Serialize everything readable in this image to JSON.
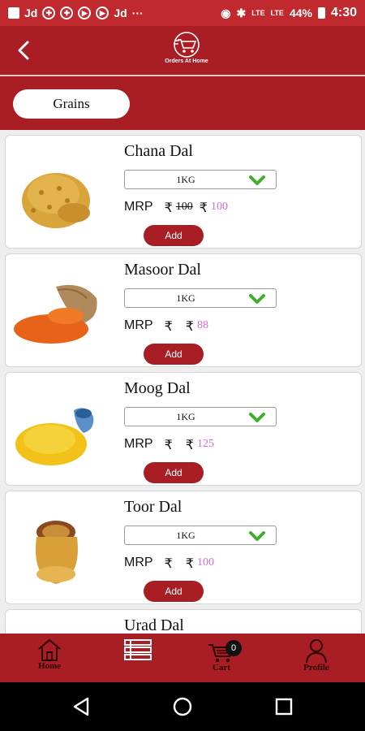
{
  "status_bar": {
    "left_items": [
      "Jd",
      "Jd",
      "···"
    ],
    "signal_labels": [
      "LTE",
      "LTE"
    ],
    "battery": "44%",
    "time": "4:30"
  },
  "header": {
    "logo_text": "Orders At Home",
    "back_icon": "chevron-left-icon",
    "logo_icon": "cart-icon"
  },
  "category": {
    "selected": "Grains"
  },
  "products": [
    {
      "name": "Chana Dal",
      "qty": "1KG",
      "mrp_label": "MRP",
      "currency": "₹",
      "old_price": "100",
      "new_price": "100",
      "add_label": "Add"
    },
    {
      "name": "Masoor Dal",
      "qty": "1KG",
      "mrp_label": "MRP",
      "currency": "₹",
      "old_price": "",
      "new_price": "88",
      "add_label": "Add"
    },
    {
      "name": "Moog Dal",
      "qty": "1KG",
      "mrp_label": "MRP",
      "currency": "₹",
      "old_price": "",
      "new_price": "125",
      "add_label": "Add"
    },
    {
      "name": "Toor Dal",
      "qty": "1KG",
      "mrp_label": "MRP",
      "currency": "₹",
      "old_price": "",
      "new_price": "100",
      "add_label": "Add"
    },
    {
      "name": "Urad Dal"
    }
  ],
  "bottom_nav": {
    "home": "Home",
    "menu_icon": "list-icon",
    "cart": "Cart",
    "cart_count": "0",
    "profile": "Profile"
  },
  "colors": {
    "primary": "#a81e24",
    "statusbar": "#c02a2f",
    "price_accent": "#d56be0",
    "chevron": "#3fae2a"
  }
}
